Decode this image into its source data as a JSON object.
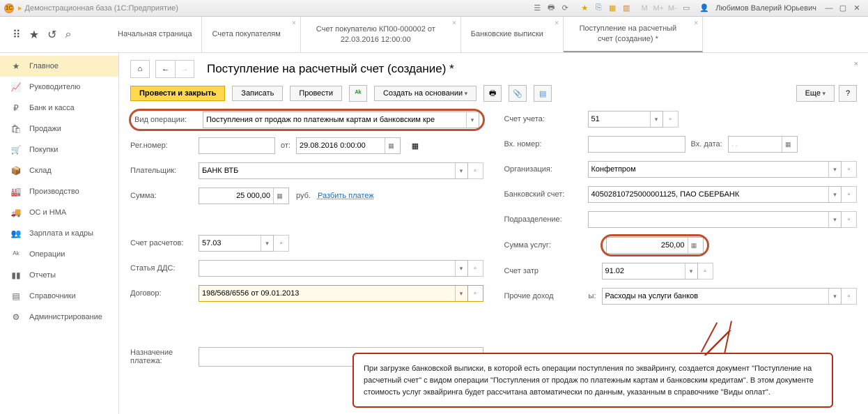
{
  "titlebar": {
    "title": "Демонстрационная база  (1С:Предприятие)",
    "user": "Любимов Валерий Юрьевич"
  },
  "tabs": {
    "t0": "Начальная страница",
    "t1": "Счета покупателям",
    "t2": "Счет покупателю КП00-000002 от 22.03.2016 12:00:00",
    "t3": "Банковские выписки",
    "t4": "Поступление на расчетный счет (создание) *"
  },
  "sidebar": {
    "s0": "Главное",
    "s1": "Руководителю",
    "s2": "Банк и касса",
    "s3": "Продажи",
    "s4": "Покупки",
    "s5": "Склад",
    "s6": "Производство",
    "s7": "ОС и НМА",
    "s8": "Зарплата и кадры",
    "s9": "Операции",
    "s10": "Отчеты",
    "s11": "Справочники",
    "s12": "Администрирование"
  },
  "page": {
    "title": "Поступление на расчетный счет (создание) *"
  },
  "toolbar": {
    "primary": "Провести и закрыть",
    "save": "Записать",
    "post": "Провести",
    "baseon": "Создать на основании",
    "more": "Еще"
  },
  "form": {
    "vid_op_lbl": "Вид операции:",
    "vid_op_val": "Поступления от продаж по платежным картам и банковским кре",
    "regnum_lbl": "Рег.номер:",
    "regnum_val": "",
    "ot_lbl": "от:",
    "date_val": "29.08.2016  0:00:00",
    "payer_lbl": "Плательщик:",
    "payer_val": "БАНК ВТБ",
    "sum_lbl": "Сумма:",
    "sum_val": "25 000,00",
    "rub": "руб.",
    "split": "Разбить платеж",
    "sch_raschet_lbl": "Счет расчетов:",
    "sch_raschet_val": "57.03",
    "dds_lbl": "Статья ДДС:",
    "dds_val": "",
    "dogovor_lbl": "Договор:",
    "dogovor_val": "198/568/6556 от 09.01.2013",
    "naznach_lbl": "Назначение платежа:",
    "schet_ucheta_lbl": "Счет учета:",
    "schet_ucheta_val": "51",
    "vxnum_lbl": "Вх. номер:",
    "vxdata_lbl": "Вх. дата:",
    "vxdata_val": ".  .",
    "org_lbl": "Организация:",
    "org_val": "Конфетпром",
    "bank_lbl": "Банковский счет:",
    "bank_val": "40502810725000001125, ПАО СБЕРБАНК",
    "podr_lbl": "Подразделение:",
    "sumusl_lbl": "Сумма услуг:",
    "sumusl_val": "250,00",
    "schetzatr_lbl": "Счет затр",
    "schetzatr_val": "91.02",
    "prochie_lbl": "Прочие доход",
    "rashody_lbl": "ы:",
    "rashody_val": "Расходы на услуги банков"
  },
  "callout": {
    "text": "При загрузке банковской выписки, в которой есть операции поступления по эквайрингу, создается документ \"Поступление на расчетный счет\" с видом операции \"Поступления от продаж по платежным картам и банковским кредитам\". В этом документе стоимость услуг эквайринга будет рассчитана автоматически по данным, указанным в справочнике \"Виды оплат\"."
  }
}
